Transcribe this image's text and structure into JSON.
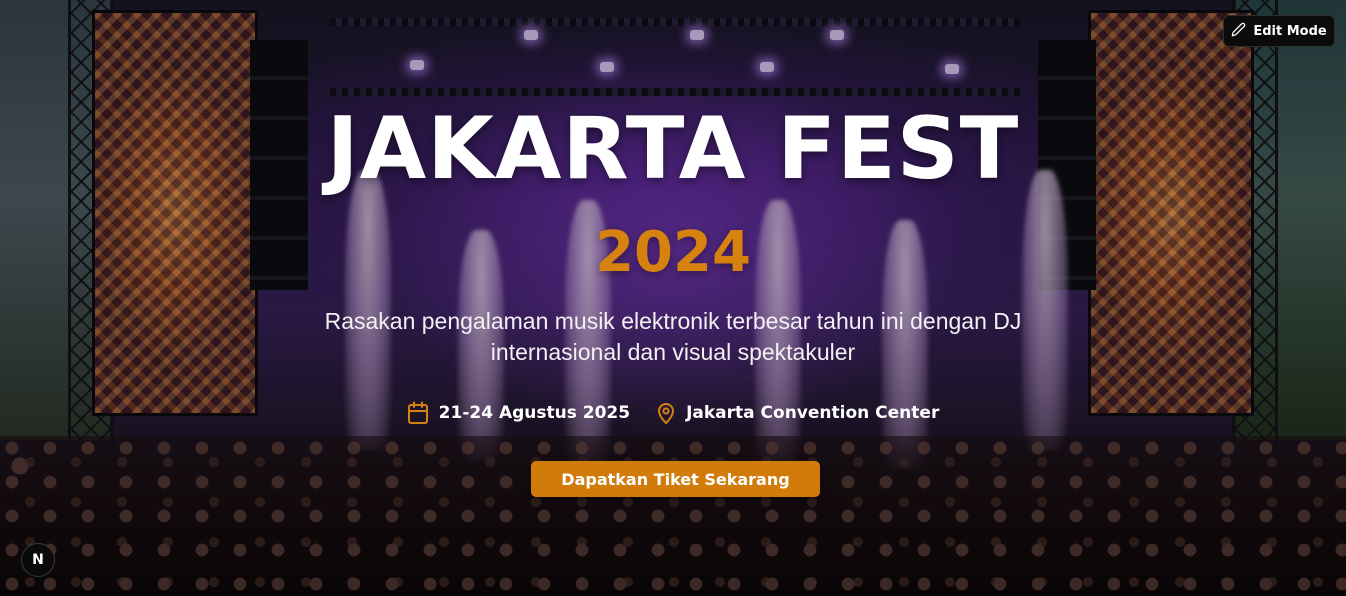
{
  "hero": {
    "title": "JAKARTA FEST",
    "year": "2024",
    "subtitle_line1": "Rasakan pengalaman musik elektronik terbesar tahun ini dengan DJ",
    "subtitle_line2": "internasional dan visual spektakuler",
    "date": "21-24 Agustus 2025",
    "venue": "Jakarta Convention Center",
    "cta_label": "Dapatkan Tiket Sekarang"
  },
  "toolbar": {
    "edit_mode_label": "Edit Mode"
  },
  "dev_badge": {
    "letter": "N"
  },
  "icons": {
    "date": "calendar-icon",
    "venue": "map-pin-icon",
    "edit": "pencil-icon"
  },
  "colors": {
    "accent": "#d7820f",
    "cta_background": "#d17c0a",
    "text": "#ffffff"
  }
}
